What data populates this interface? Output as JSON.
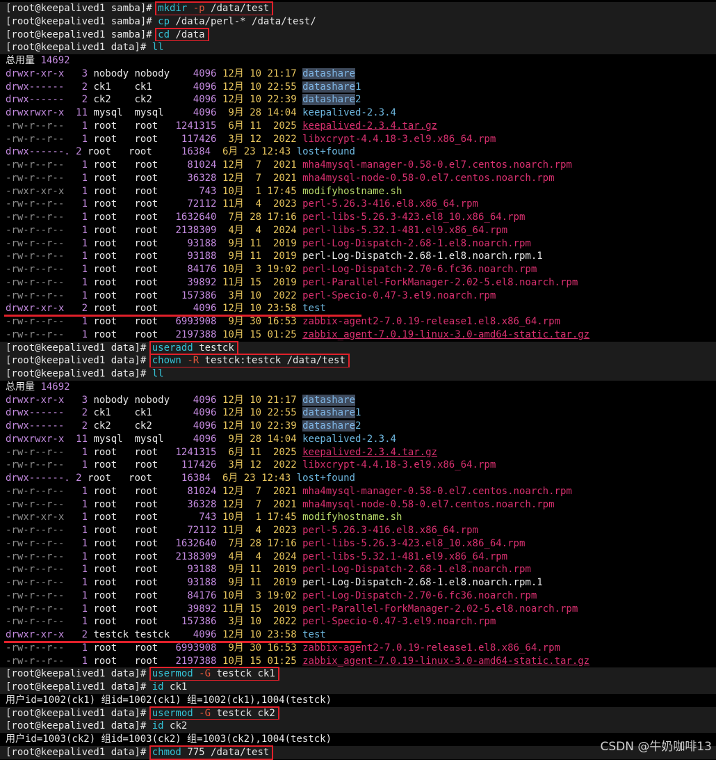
{
  "prompts": {
    "samba": "[root@keepalived1 samba]# ",
    "data": "[root@keepalived1 data]# "
  },
  "commands": {
    "mkdir": {
      "cmd": "mkdir",
      "opt": "-p",
      "arg": "/data/test"
    },
    "cp": {
      "cmd": "cp",
      "arg": "/data/perl-* /data/test/"
    },
    "cd": {
      "cmd": "cd",
      "arg": "/data"
    },
    "ll": {
      "cmd": "ll"
    },
    "useradd": {
      "cmd": "useradd",
      "arg": "testck"
    },
    "chown": {
      "cmd": "chown",
      "opt": "-R",
      "arg": "testck:testck /data/test"
    },
    "usermod_ck1": {
      "cmd": "usermod",
      "opt": "-G",
      "arg": "testck ck1"
    },
    "id_ck1": {
      "cmd": "id",
      "arg": "ck1"
    },
    "usermod_ck2": {
      "cmd": "usermod",
      "opt": "-G",
      "arg": "testck ck2"
    },
    "id_ck2": {
      "cmd": "id",
      "arg": "ck2"
    },
    "chmod": {
      "cmd": "chmod",
      "arg": "775 /data/test"
    }
  },
  "total_line": {
    "label": "总用量 ",
    "value": "14692"
  },
  "listing_before": [
    {
      "perm": "drwxr-xr-x ",
      "links": "  3",
      "owner": "nobody",
      "group": "nobody",
      "size": "   4096",
      "date": "12月 10 21:17",
      "name": "datashare",
      "style": "hl"
    },
    {
      "perm": "drwx------ ",
      "links": "  2",
      "owner": "ck1   ",
      "group": "ck1   ",
      "size": "   4096",
      "date": "12月 10 22:55",
      "name": "datashare1",
      "style": "hl1"
    },
    {
      "perm": "drwx------ ",
      "links": "  2",
      "owner": "ck2   ",
      "group": "ck2   ",
      "size": "   4096",
      "date": "12月 10 22:39",
      "name": "datashare2",
      "style": "hl1"
    },
    {
      "perm": "drwxrwxr-x ",
      "links": " 11",
      "owner": "mysql ",
      "group": "mysql ",
      "size": "   4096",
      "date": " 9月 28 14:04",
      "name": "keepalived-2.3.4",
      "style": "dir"
    },
    {
      "perm": "-rw-r--r-- ",
      "links": "  1",
      "owner": "root  ",
      "group": "root  ",
      "size": "1241315",
      "date": " 6月 11  2025",
      "name": "keepalived-2.3.4.tar.gz",
      "style": "ul"
    },
    {
      "perm": "-rw-r--r-- ",
      "links": "  1",
      "owner": "root  ",
      "group": "root  ",
      "size": " 117426",
      "date": " 3月 12  2022",
      "name": "libxcrypt-4.4.18-3.el9.x86_64.rpm",
      "style": "red"
    },
    {
      "perm": "drwx------. ",
      "links": "2",
      "owner": "root  ",
      "group": "root  ",
      "size": "  16384",
      "date": " 6月 23 12:43",
      "name": "lost+found",
      "style": "dir"
    },
    {
      "perm": "-rw-r--r-- ",
      "links": "  1",
      "owner": "root  ",
      "group": "root  ",
      "size": "  81024",
      "date": "12月  7  2021",
      "name": "mha4mysql-manager-0.58-0.el7.centos.noarch.rpm",
      "style": "red"
    },
    {
      "perm": "-rw-r--r-- ",
      "links": "  1",
      "owner": "root  ",
      "group": "root  ",
      "size": "  36328",
      "date": "12月  7  2021",
      "name": "mha4mysql-node-0.58-0.el7.centos.noarch.rpm",
      "style": "red"
    },
    {
      "perm": "-rwxr-xr-x ",
      "links": "  1",
      "owner": "root  ",
      "group": "root  ",
      "size": "    743",
      "date": "10月  1 17:45",
      "name": "modifyhostname.sh",
      "style": "exec"
    },
    {
      "perm": "-rw-r--r-- ",
      "links": "  1",
      "owner": "root  ",
      "group": "root  ",
      "size": "  72112",
      "date": "11月  4  2023",
      "name": "perl-5.26.3-416.el8.x86_64.rpm",
      "style": "red"
    },
    {
      "perm": "-rw-r--r-- ",
      "links": "  1",
      "owner": "root  ",
      "group": "root  ",
      "size": "1632640",
      "date": " 7月 28 17:16",
      "name": "perl-libs-5.26.3-423.el8_10.x86_64.rpm",
      "style": "red"
    },
    {
      "perm": "-rw-r--r-- ",
      "links": "  1",
      "owner": "root  ",
      "group": "root  ",
      "size": "2138309",
      "date": " 4月  4  2024",
      "name": "perl-libs-5.32.1-481.el9.x86_64.rpm",
      "style": "red"
    },
    {
      "perm": "-rw-r--r-- ",
      "links": "  1",
      "owner": "root  ",
      "group": "root  ",
      "size": "  93188",
      "date": " 9月 11  2019",
      "name": "perl-Log-Dispatch-2.68-1.el8.noarch.rpm",
      "style": "red"
    },
    {
      "perm": "-rw-r--r-- ",
      "links": "  1",
      "owner": "root  ",
      "group": "root  ",
      "size": "  93188",
      "date": " 9月 11  2019",
      "name": "perl-Log-Dispatch-2.68-1.el8.noarch.rpm.1",
      "style": "plain"
    },
    {
      "perm": "-rw-r--r-- ",
      "links": "  1",
      "owner": "root  ",
      "group": "root  ",
      "size": "  84176",
      "date": "10月  3 19:02",
      "name": "perl-Log-Dispatch-2.70-6.fc36.noarch.rpm",
      "style": "red"
    },
    {
      "perm": "-rw-r--r-- ",
      "links": "  1",
      "owner": "root  ",
      "group": "root  ",
      "size": "  39892",
      "date": "11月 15  2019",
      "name": "perl-Parallel-ForkManager-2.02-5.el8.noarch.rpm",
      "style": "red"
    },
    {
      "perm": "-rw-r--r-- ",
      "links": "  1",
      "owner": "root  ",
      "group": "root  ",
      "size": " 157386",
      "date": " 3月 10  2022",
      "name": "perl-Specio-0.47-3.el9.noarch.rpm",
      "style": "red"
    },
    {
      "perm": "drwxr-xr-x ",
      "links": "  2",
      "owner": "root  ",
      "group": "root  ",
      "size": "   4096",
      "date": "12月 10 23:58",
      "name": "test",
      "style": "dir"
    },
    {
      "perm": "-rw-r--r-- ",
      "links": "  1",
      "owner": "root  ",
      "group": "root  ",
      "size": "6993908",
      "date": " 9月 30 16:53",
      "name": "zabbix-agent2-7.0.19-release1.el8.x86_64.rpm",
      "style": "red"
    },
    {
      "perm": "-rw-r--r-- ",
      "links": "  1",
      "owner": "root  ",
      "group": "root  ",
      "size": "2197388",
      "date": "10月 15 01:25",
      "name": "zabbix_agent-7.0.19-linux-3.0-amd64-static.tar.gz",
      "style": "ul"
    }
  ],
  "listing_after_test": {
    "perm": "drwxr-xr-x ",
    "links": "  2",
    "owner": "testck",
    "group": "testck",
    "size": "   4096",
    "date": "12月 10 23:58",
    "name": "test",
    "style": "dir"
  },
  "id_outputs": {
    "ck1": "用户id=1002(ck1) 组id=1002(ck1) 组=1002(ck1),1004(testck)",
    "ck2": "用户id=1003(ck2) 组id=1003(ck2) 组=1003(ck2),1004(testck)"
  },
  "watermark": "CSDN @牛奶咖啡13",
  "colors": {
    "highlight_box": "#e0202a",
    "background": "#000000"
  }
}
